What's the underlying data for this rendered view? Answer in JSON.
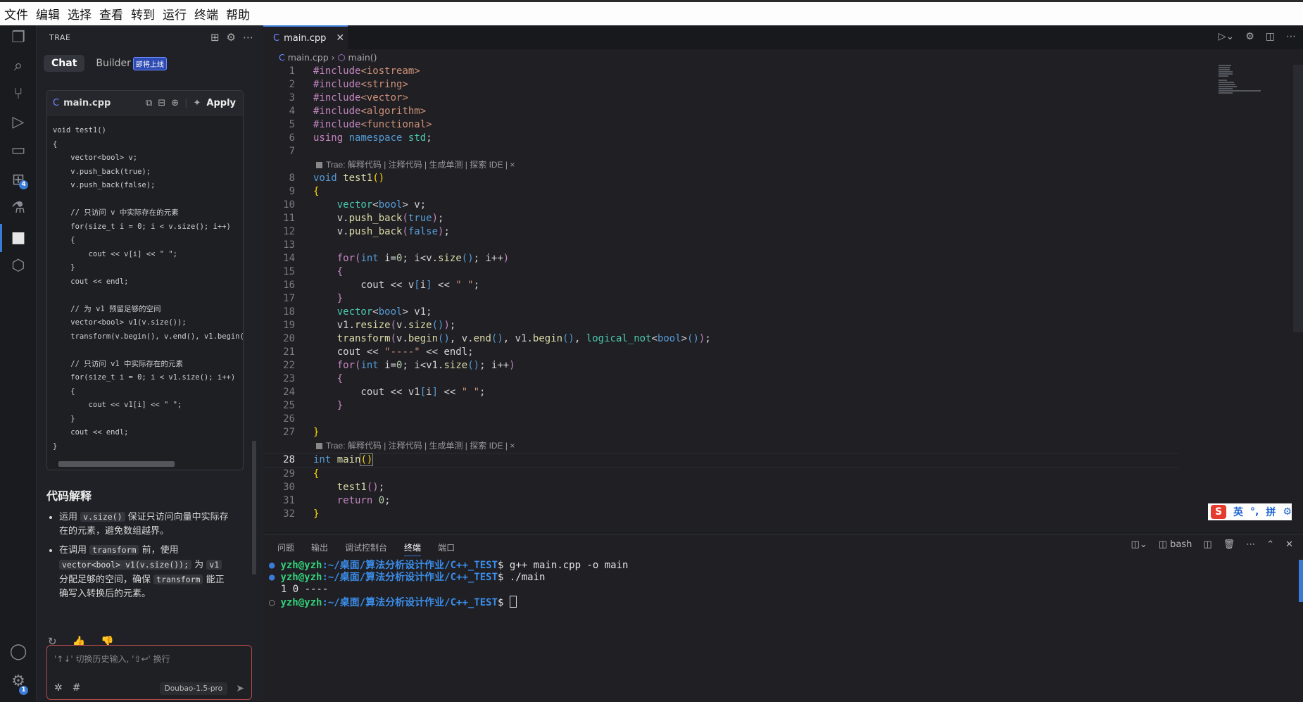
{
  "menu": [
    "文件",
    "编辑",
    "选择",
    "查看",
    "转到",
    "运行",
    "终端",
    "帮助"
  ],
  "activity": {
    "icons": [
      "explorer-icon",
      "search-icon",
      "source-control-icon",
      "run-debug-icon",
      "remote-icon",
      "extensions-icon",
      "testing-icon",
      "trae-icon",
      "package-icon"
    ],
    "extensions_badge": "4",
    "settings_badge": "1"
  },
  "side": {
    "title": "TRAE",
    "chat_tab": "Chat",
    "builder_tab": "Builder",
    "soon_badge": "即将上线",
    "codecard": {
      "file": "main.cpp",
      "apply": "Apply",
      "code": "void test1()\n{\n    vector<bool> v;\n    v.push_back(true);\n    v.push_back(false);\n\n    // 只访问 v 中实际存在的元素\n    for(size_t i = 0; i < v.size(); i++)\n    {\n        cout << v[i] << \" \";\n    }\n    cout << endl;\n\n    // 为 v1 预留足够的空间\n    vector<bool> v1(v.size());\n    transform(v.begin(), v.end(), v1.begin()\n\n    // 只访问 v1 中实际存在的元素\n    for(size_t i = 0; i < v1.size(); i++)\n    {\n        cout << v1[i] << \" \";\n    }\n    cout << endl;\n}"
    },
    "explain_title": "代码解释",
    "bullet1": {
      "pre": "运用 ",
      "code": "v.size()",
      "post": " 保证只访问向量中实际存在的元素，避免数组越界。"
    },
    "bullet2": {
      "pre": "在调用 ",
      "code1": "transform",
      "mid1": " 前，使用 ",
      "code2": "vector<bool> v1(v.size());",
      "mid2": " 为 ",
      "code3": "v1",
      "mid3": " 分配足够的空间，确保 ",
      "code4": "transform",
      "post": " 能正确写入转换后的元素。"
    },
    "input_placeholder": "'↑↓' 切换历史输入, '⇧↩' 换行",
    "model": "Doubao-1.5-pro"
  },
  "editor": {
    "tab": "main.cpp",
    "breadcrumb_file": "main.cpp",
    "breadcrumb_symbol": "main()",
    "codelens": "Trae: 解释代码 | 注释代码 | 生成单测 | 探索 IDE | ×",
    "current_line": 28
  },
  "panel": {
    "tabs": [
      "问题",
      "输出",
      "调试控制台",
      "终端",
      "端口"
    ],
    "active_tab": "终端",
    "shell": "bash",
    "prompt_user": "yzh@yzh",
    "prompt_path": ":~/桌面/算法分析设计作业/C++_TEST",
    "cmd1": "$ g++ main.cpp -o main",
    "cmd2": "$ ./main",
    "output": "1 0 ----",
    "cmd3": "$ "
  },
  "ime": {
    "lang": "英",
    "mode": "拼"
  },
  "colors": {
    "accent": "#3a7bd5",
    "prompt_user": "#33d17a",
    "prompt_path": "#3b8eea"
  }
}
